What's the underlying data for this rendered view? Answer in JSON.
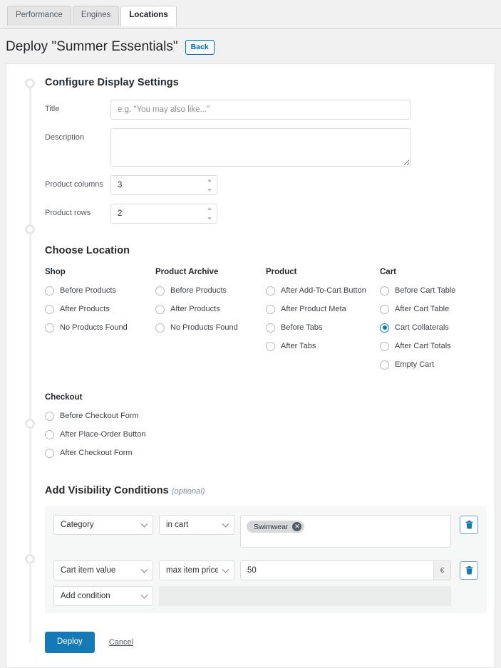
{
  "tabs": [
    {
      "label": "Performance",
      "active": false
    },
    {
      "label": "Engines",
      "active": false
    },
    {
      "label": "Locations",
      "active": true
    }
  ],
  "header": {
    "title": "Deploy \"Summer Essentials\"",
    "back_label": "Back"
  },
  "display_settings": {
    "section_title": "Configure Display Settings",
    "fields": {
      "title": {
        "label": "Title",
        "value": "",
        "placeholder": "e.g. \"You may also like...\""
      },
      "description": {
        "label": "Description",
        "value": "",
        "placeholder": ""
      },
      "product_columns": {
        "label": "Product columns",
        "value": "3"
      },
      "product_rows": {
        "label": "Product rows",
        "value": "2"
      }
    }
  },
  "choose_location": {
    "section_title": "Choose Location",
    "groups": [
      {
        "name": "Shop",
        "options": [
          {
            "label": "Before Products",
            "checked": false
          },
          {
            "label": "After Products",
            "checked": false
          },
          {
            "label": "No Products Found",
            "checked": false
          }
        ]
      },
      {
        "name": "Product Archive",
        "options": [
          {
            "label": "Before Products",
            "checked": false
          },
          {
            "label": "After Products",
            "checked": false
          },
          {
            "label": "No Products Found",
            "checked": false
          }
        ]
      },
      {
        "name": "Product",
        "options": [
          {
            "label": "After Add-To-Cart Button",
            "checked": false
          },
          {
            "label": "After Product Meta",
            "checked": false
          },
          {
            "label": "Before Tabs",
            "checked": false
          },
          {
            "label": "After Tabs",
            "checked": false
          }
        ]
      },
      {
        "name": "Cart",
        "options": [
          {
            "label": "Before Cart Table",
            "checked": false
          },
          {
            "label": "After Cart Table",
            "checked": false
          },
          {
            "label": "Cart Collaterals",
            "checked": true
          },
          {
            "label": "After Cart Totals",
            "checked": false
          },
          {
            "label": "Empty Cart",
            "checked": false
          }
        ]
      }
    ],
    "checkout_group": {
      "name": "Checkout",
      "options": [
        {
          "label": "Before Checkout Form",
          "checked": false
        },
        {
          "label": "After Place-Order Button",
          "checked": false
        },
        {
          "label": "After Checkout Form",
          "checked": false
        }
      ]
    }
  },
  "visibility": {
    "section_title": "Add Visibility Conditions",
    "optional_note": "(optional)",
    "rows": [
      {
        "type": "tags",
        "condition": "Category",
        "operator": "in cart",
        "tags": [
          {
            "label": "Swimwear",
            "remove": "✕"
          }
        ],
        "delete_icon": "trash-icon"
      },
      {
        "type": "value",
        "condition": "Cart item value",
        "operator": "max item price >=",
        "value": "50",
        "suffix": "€",
        "delete_icon": "trash-icon"
      },
      {
        "type": "add",
        "condition": "Add condition"
      }
    ]
  },
  "footer": {
    "deploy_label": "Deploy",
    "cancel_label": "Cancel"
  },
  "colors": {
    "accent": "#1579b5",
    "radio_checked": "#007cba",
    "page_bg": "#f1f1f1",
    "panel_bg": "#f6f7f7"
  }
}
